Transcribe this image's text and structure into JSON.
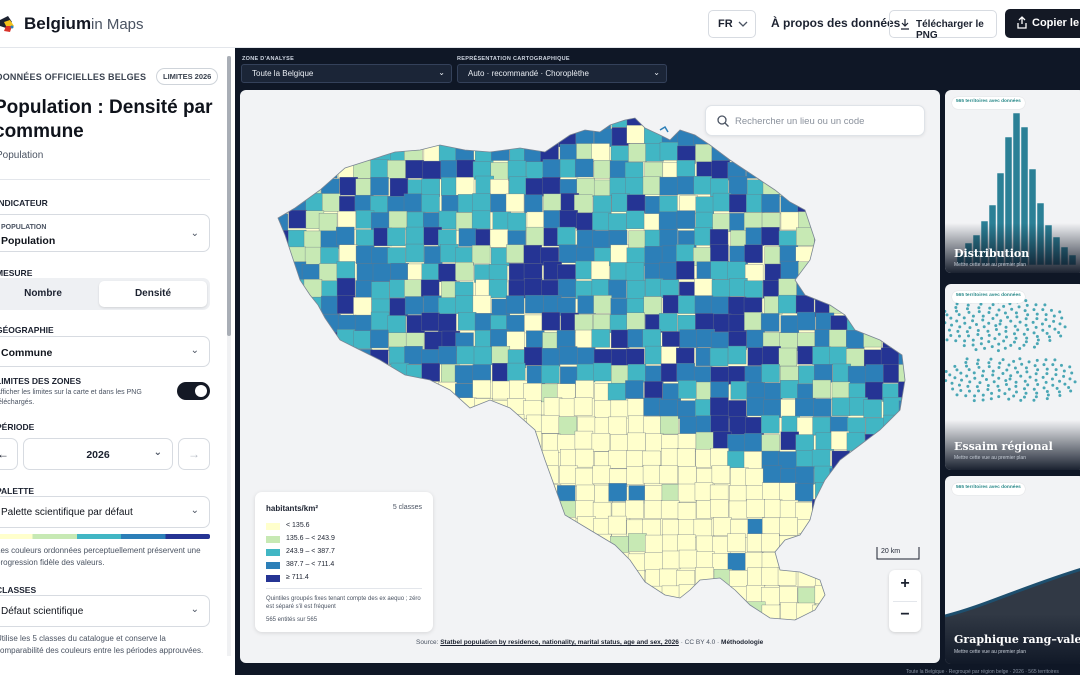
{
  "header": {
    "brand": "Belgium",
    "brand_sub": "in Maps",
    "lang": "FR",
    "about": "À propos des données",
    "download": "Télécharger le PNG",
    "copy": "Copier le lien"
  },
  "sidebar": {
    "eyebrow": "DONNÉES OFFICIELLES BELGES",
    "badge": "LIMITES 2026",
    "title": "Population : Densité par commune",
    "subtitle": "Population",
    "indicator_label": "INDICATEUR",
    "indicator_small": "POPULATION",
    "indicator_value": "Population",
    "measure_label": "MESURE",
    "measure_options": [
      "Nombre",
      "Densité"
    ],
    "geo_label": "GÉOGRAPHIE",
    "geo_value": "Commune",
    "limits_label": "LIMITES DES ZONES",
    "limits_help": "Afficher les limites sur la carte et dans les PNG téléchargés.",
    "period_label": "PÉRIODE",
    "period_prev": "←",
    "period_value": "2026",
    "period_next": "→",
    "palette_label": "PALETTE",
    "palette_value": "Palette scientifique par défaut",
    "palette_help": "Les couleurs ordonnées perceptuellement préservent une progression fidèle des valeurs.",
    "classes_label": "CLASSES",
    "classes_value": "Défaut scientifique",
    "classes_help": "Utilise les 5 classes du catalogue et conserve la comparabilité des couleurs entre les périodes approuvées."
  },
  "controls": {
    "zone_label": "ZONE D'ANALYSE",
    "zone_value": "Toute la Belgique",
    "repr_label": "REPRÉSENTATION CARTOGRAPHIQUE",
    "repr_value": "Auto · recommandé · Choroplèthe"
  },
  "map": {
    "search_placeholder": "Rechercher un lieu ou un code",
    "scale": "20 km",
    "zoom_in": "+",
    "zoom_out": "−",
    "source_prefix": "Source: ",
    "source_link": "Statbel population by residence, nationality, marital status, age and sex, 2026",
    "license": "· CC BY 4.0 ·",
    "methodology": "Méthodologie"
  },
  "legend": {
    "title": "habitants/km²",
    "count": "5 classes",
    "classes": [
      {
        "label": "< 135.6",
        "color": "#ffffcc"
      },
      {
        "label": "135.6 – < 243.9",
        "color": "#c7e9b4"
      },
      {
        "label": "243.9 – < 387.7",
        "color": "#41b6c4"
      },
      {
        "label": "387.7 – < 711.4",
        "color": "#2c7fb8"
      },
      {
        "label": "≥ 711.4",
        "color": "#253494"
      }
    ],
    "note": "Quintiles groupés fixes tenant compte des ex aequo ; zéro est séparé s'il est fréquent",
    "entities": "565 entités sur 565"
  },
  "cards": [
    {
      "tag": "565 territoires avec données",
      "title": "Distribution",
      "sub": "Mettre cette vue au premier plan"
    },
    {
      "tag": "565 territoires avec données",
      "title": "Essaim régional",
      "sub": "Mettre cette vue au premier plan"
    },
    {
      "tag": "565 territoires avec données",
      "title": "Graphique rang–valeur",
      "sub": "Mettre cette vue au premier plan"
    }
  ],
  "footer_note": "Toute la Belgique · Regroupé par région belge · 2026 · 565 territoires"
}
